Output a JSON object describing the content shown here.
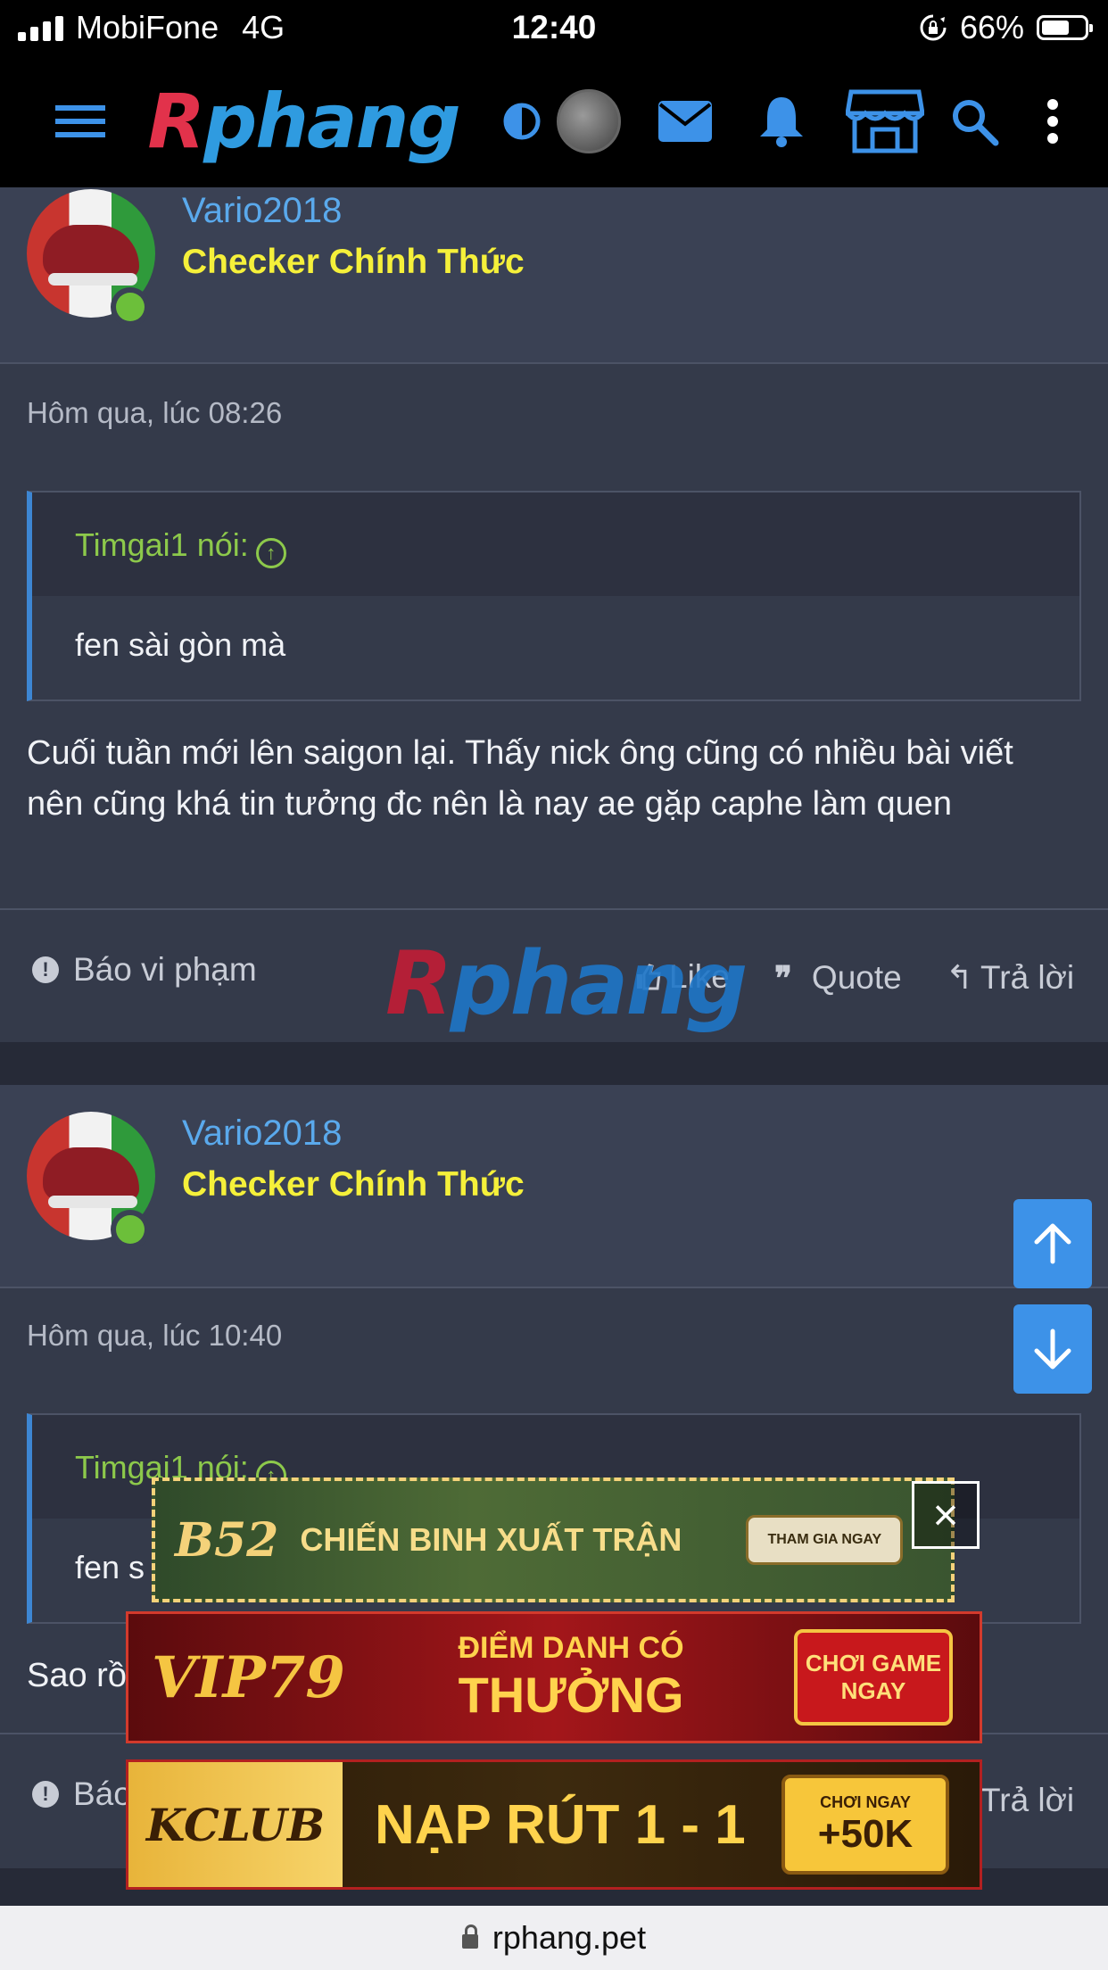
{
  "status_bar": {
    "carrier": "MobiFone",
    "network": "4G",
    "time": "12:40",
    "battery_percent": "66%",
    "battery_level": 0.66
  },
  "nav": {
    "logo_r": "R",
    "logo_rest": "phang"
  },
  "colors": {
    "nav_bg": "#000000",
    "page_bg": "#262a37",
    "post_bg": "#343a4a",
    "username": "#5aa9ec",
    "user_title": "#f5f03a",
    "quote_author": "#8dc94b",
    "accent": "#3d92e8"
  },
  "posts": [
    {
      "username": "Vario2018",
      "user_title": "Checker Chính Thức",
      "time": "Hôm qua, lúc 08:26",
      "quote_author": "Timgai1 nói:",
      "quote_text": "fen sài gòn mà",
      "body": "Cuối tuần mới lên saigon lại. Thấy nick ông cũng có nhiều bài viết nên cũng khá tin tưởng đc nên là nay ae gặp caphe làm quen",
      "actions": {
        "report": "Báo vi phạm",
        "like": "Like",
        "quote": "Quote",
        "reply": "Trả lời"
      }
    },
    {
      "username": "Vario2018",
      "user_title": "Checker Chính Thức",
      "time": "Hôm qua, lúc 10:40",
      "quote_author": "Timgai1 nói:",
      "quote_text": "fen s",
      "body": "Sao rồ",
      "actions": {
        "report": "Báo",
        "reply": "Trả lời"
      }
    }
  ],
  "watermark": {
    "r": "R",
    "rest": "phang"
  },
  "ads": [
    {
      "brand": "B52",
      "headline": "CHIẾN BINH XUẤT TRẬN",
      "cta": "THAM GIA NGAY"
    },
    {
      "brand": "VIP79",
      "headline_top": "ĐIỂM DANH CÓ",
      "headline_bottom": "THƯỞNG",
      "cta": "CHƠI GAME NGAY"
    },
    {
      "brand": "KCLUB",
      "headline": "NẠP RÚT 1 - 1",
      "cta_top": "CHƠI NGAY",
      "cta": "+50K"
    }
  ],
  "ad_close": "×",
  "url": "rphang.pet"
}
